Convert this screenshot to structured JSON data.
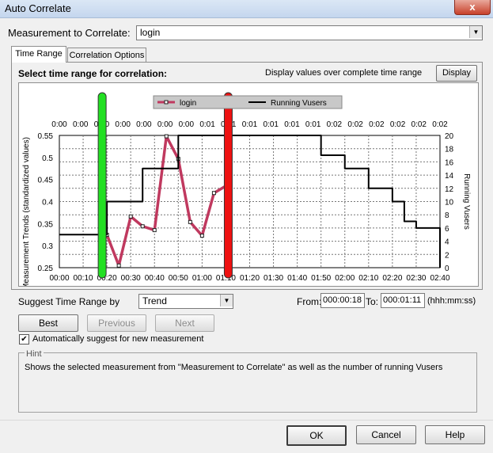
{
  "window": {
    "title": "Auto Correlate",
    "close_glyph": "x"
  },
  "measurement": {
    "label": "Measurement to Correlate:",
    "value": "login"
  },
  "tabs": [
    {
      "label": "Time Range",
      "active": true
    },
    {
      "label": "Correlation Options",
      "active": false
    }
  ],
  "panel": {
    "select_label": "Select time range for correlation:",
    "display_label": "Display values over complete time range",
    "display_button": "Display"
  },
  "chart_data": {
    "type": "line",
    "legend": [
      "login",
      "Running Vusers"
    ],
    "legend_position": "top-center",
    "ylabel": "Measurement Trends (standardized values)",
    "y2label": "Running Vusers",
    "y_ticks": [
      "0.55",
      "0.5",
      "0.45",
      "0.4",
      "0.35",
      "0.3",
      "0.25"
    ],
    "y_range": [
      0.245,
      0.555
    ],
    "y2_ticks": [
      "20",
      "18",
      "16",
      "14",
      "12",
      "10",
      "8",
      "6",
      "4",
      "2",
      "0"
    ],
    "y2_range": [
      0,
      20
    ],
    "x_range_minutes": [
      0,
      2.6667
    ],
    "x_ticks_bottom": [
      "00:00",
      "00:10",
      "00:20",
      "00:30",
      "00:40",
      "00:50",
      "01:00",
      "01:10",
      "01:20",
      "01:30",
      "01:40",
      "01:50",
      "02:00",
      "02:10",
      "02:20",
      "02:30",
      "02:40"
    ],
    "x_ticks_top": [
      "0:00",
      "0:00",
      "0:00",
      "0:00",
      "0:00",
      "0:00",
      "0:00",
      "0:01",
      "0:01",
      "0:01",
      "0:01",
      "0:01",
      "0:01",
      "0:02",
      "0:02",
      "0:02",
      "0:02",
      "0:02",
      "0:02"
    ],
    "grid": true,
    "series": [
      {
        "name": "login",
        "axis": "left",
        "color": "#c0395f",
        "x": [
          0.3333,
          0.4167,
          0.5,
          0.5833,
          0.6667,
          0.75,
          0.8333,
          0.9167,
          1.0,
          1.0833,
          1.1833
        ],
        "y": [
          0.322,
          0.25,
          0.365,
          0.342,
          0.333,
          0.553,
          0.5,
          0.352,
          0.32,
          0.42,
          0.44
        ]
      },
      {
        "name": "Running Vusers",
        "axis": "right",
        "color": "#000000",
        "step": true,
        "x": [
          0.0,
          0.3333,
          0.3333,
          0.5833,
          0.5833,
          0.8333,
          0.8333,
          1.8333,
          1.8333,
          2.0,
          2.0,
          2.1667,
          2.1667,
          2.3333,
          2.3333,
          2.4167,
          2.4167,
          2.5,
          2.5,
          2.6667,
          2.6667
        ],
        "y": [
          5,
          5,
          10,
          10,
          15,
          15,
          20,
          20,
          17,
          17,
          15,
          15,
          12,
          12,
          10,
          10,
          7,
          7,
          6,
          6,
          0
        ]
      }
    ],
    "range_markers": [
      {
        "color": "#22e022",
        "x": 0.3
      },
      {
        "color": "#ee1111",
        "x": 1.1833
      }
    ]
  },
  "suggest": {
    "label": "Suggest Time Range by",
    "value": "Trend",
    "from_label": "From:",
    "from_value": "000:00:18",
    "to_label": "To:",
    "to_value": "000:01:11",
    "format_label": "(hhh:mm:ss)"
  },
  "buttons": {
    "best": "Best",
    "previous": "Previous",
    "next": "Next",
    "ok": "OK",
    "cancel": "Cancel",
    "help": "Help"
  },
  "auto_suggest": {
    "label": "Automatically suggest for new measurement",
    "checked": true,
    "check_glyph": "✔"
  },
  "hint": {
    "title": "Hint",
    "text": "Shows the selected measurement from \"Measurement to Correlate\" as well as the number of running Vusers"
  }
}
